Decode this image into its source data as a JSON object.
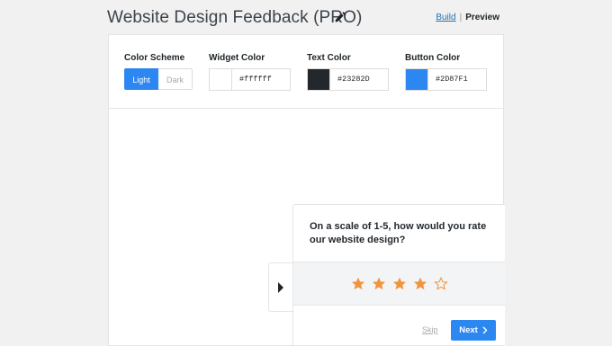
{
  "header": {
    "title": "Website Design Feedback (PRO)",
    "build_label": "Build",
    "separator": "|",
    "preview_label": "Preview"
  },
  "settings": {
    "color_scheme": {
      "label": "Color Scheme",
      "options": [
        "Light",
        "Dark"
      ],
      "selected": "Light"
    },
    "widget_color": {
      "label": "Widget Color",
      "value": "#ffffff"
    },
    "text_color": {
      "label": "Text Color",
      "value": "#23282D"
    },
    "button_color": {
      "label": "Button Color",
      "value": "#2D87F1"
    }
  },
  "survey": {
    "question": "On a scale of 1-5, how would you rate our website design?",
    "rating_max": 5,
    "rating_value": 4,
    "skip_label": "Skip",
    "next_label": "Next"
  },
  "colors": {
    "accent": "#2d87f1",
    "star": "#f0943e",
    "text": "#23282d"
  },
  "icons": {
    "edit": "pencil-icon",
    "collapse": "caret-right-icon",
    "next": "chevron-right-icon",
    "rating": "star-icon"
  }
}
